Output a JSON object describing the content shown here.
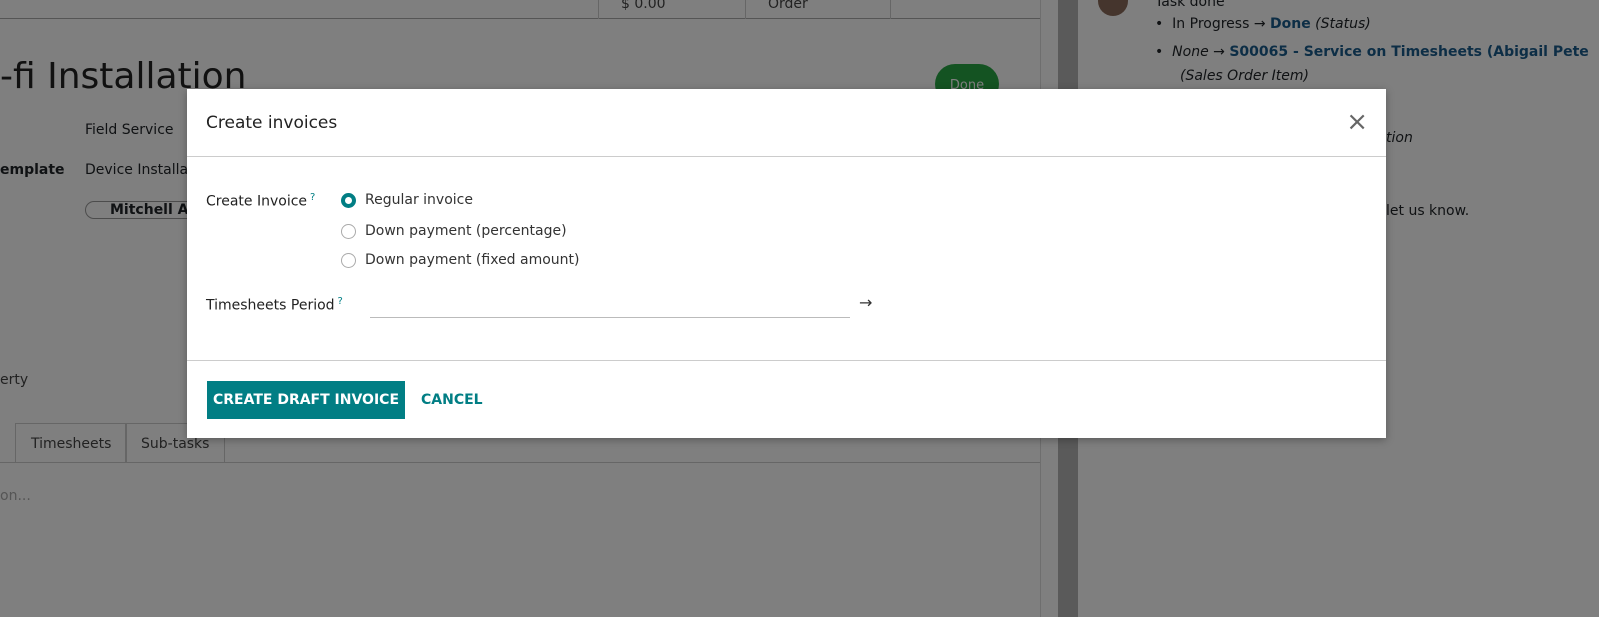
{
  "background": {
    "stat_buttons": [
      "$ 0.00",
      "Order",
      ""
    ],
    "title": "-fi Installation",
    "status_badge": "Done",
    "fields": [
      {
        "label": "",
        "value": "Field Service"
      },
      {
        "label": "emplate",
        "value": "Device Installat"
      }
    ],
    "assignee": "Mitchell Ad",
    "property_label": "erty",
    "tabs": [
      "Timesheets",
      "Sub-tasks"
    ],
    "description_placeholder": "on...",
    "chatter": {
      "header": "Task done",
      "change1_from": "In Progress",
      "change1_to": "Done",
      "change1_field": "(Status)",
      "change2_from": "None",
      "change2_to": "S00065 - Service on Timesheets (Abigail Pete",
      "change2_field": "(Sales Order Item)",
      "fragment1": "tion",
      "fragment2": "let us know."
    }
  },
  "modal": {
    "title": "Create invoices",
    "create_invoice_label": "Create Invoice",
    "help_mark": "?",
    "options": [
      {
        "label": "Regular invoice",
        "selected": true
      },
      {
        "label": "Down payment (percentage)",
        "selected": false
      },
      {
        "label": "Down payment (fixed amount)",
        "selected": false
      }
    ],
    "timesheets_period_label": "Timesheets Period",
    "timesheets_period_start": "",
    "arrow": "→",
    "create_button": "CREATE DRAFT INVOICE",
    "cancel_button": "CANCEL",
    "close": "×"
  },
  "colors": {
    "accent": "#017e84",
    "done": "#28a745"
  }
}
